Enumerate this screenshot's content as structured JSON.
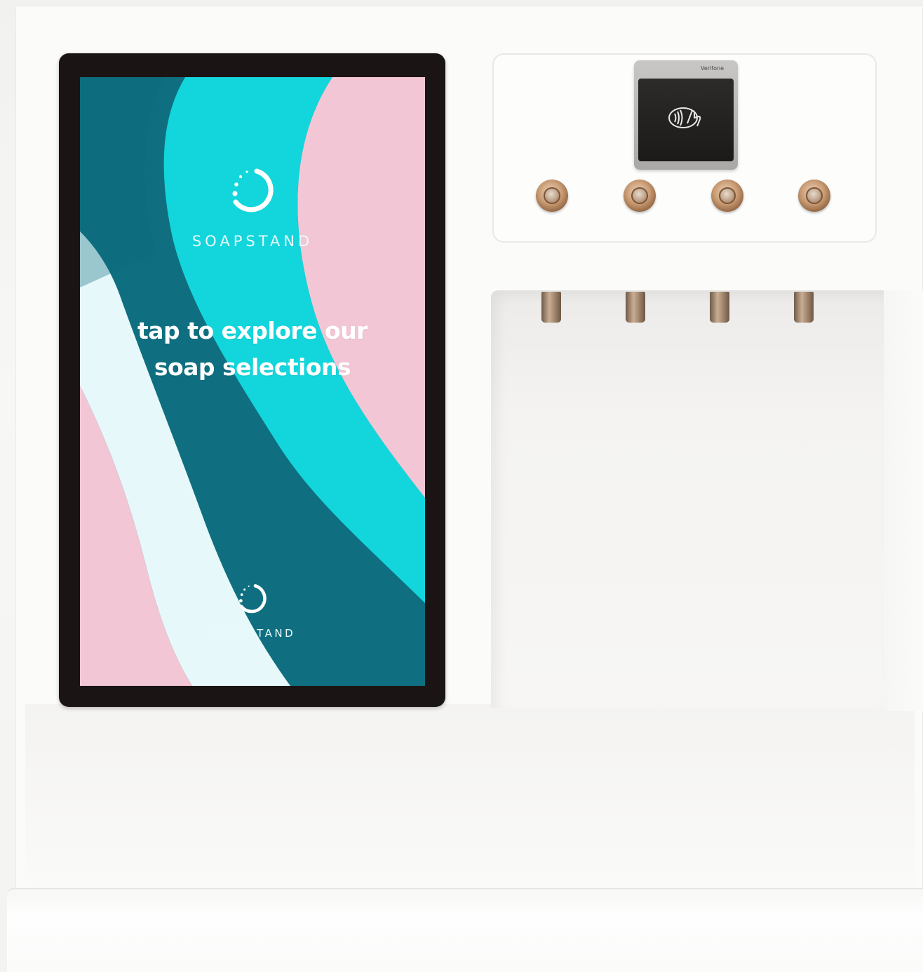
{
  "kiosk": {
    "screen": {
      "brand_top": "SOAPSTAND",
      "headline_line1": "tap to explore our",
      "headline_line2": "soap selections",
      "brand_bottom": "SOAPSTAND",
      "colors": {
        "teal_dark": "#0e7d8d",
        "teal_mid": "#0f6f80",
        "cyan": "#12d6dc",
        "pink": "#f2c6d4",
        "pale": "#e6f8f9"
      }
    },
    "card_reader": {
      "brand": "Verifone",
      "icon": "contactless-tap-icon"
    },
    "buttons": [
      {
        "name": "dispense-button-1"
      },
      {
        "name": "dispense-button-2"
      },
      {
        "name": "dispense-button-3"
      },
      {
        "name": "dispense-button-4"
      }
    ],
    "nozzles": [
      {
        "name": "nozzle-1"
      },
      {
        "name": "nozzle-2"
      },
      {
        "name": "nozzle-3"
      },
      {
        "name": "nozzle-4"
      }
    ]
  }
}
